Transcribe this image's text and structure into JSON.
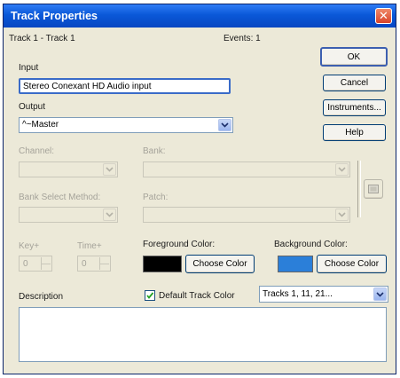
{
  "window": {
    "title": "Track Properties"
  },
  "header": {
    "track_label": "Track 1 - Track 1",
    "events_label": "Events: 1"
  },
  "buttons": {
    "ok": "OK",
    "cancel": "Cancel",
    "instruments": "Instruments...",
    "help": "Help"
  },
  "input": {
    "label": "Input",
    "value": "Stereo Conexant HD Audio input"
  },
  "output": {
    "label": "Output",
    "value": "^~Master"
  },
  "channel": {
    "label": "Channel:",
    "value": ""
  },
  "bank": {
    "label": "Bank:",
    "value": ""
  },
  "bank_select": {
    "label": "Bank Select Method:",
    "value": ""
  },
  "patch": {
    "label": "Patch:",
    "value": ""
  },
  "key": {
    "label": "Key+",
    "value": "0"
  },
  "time": {
    "label": "Time+",
    "value": "0"
  },
  "foreground": {
    "label": "Foreground Color:",
    "button": "Choose Color",
    "color": "#000000"
  },
  "background": {
    "label": "Background Color:",
    "button": "Choose Color",
    "color": "#2b7fd9"
  },
  "description": {
    "label": "Description",
    "value": ""
  },
  "default_track_color": {
    "label": "Default Track Color",
    "checked": true
  },
  "tracks_combo": {
    "value": "Tracks 1, 11, 21..."
  }
}
